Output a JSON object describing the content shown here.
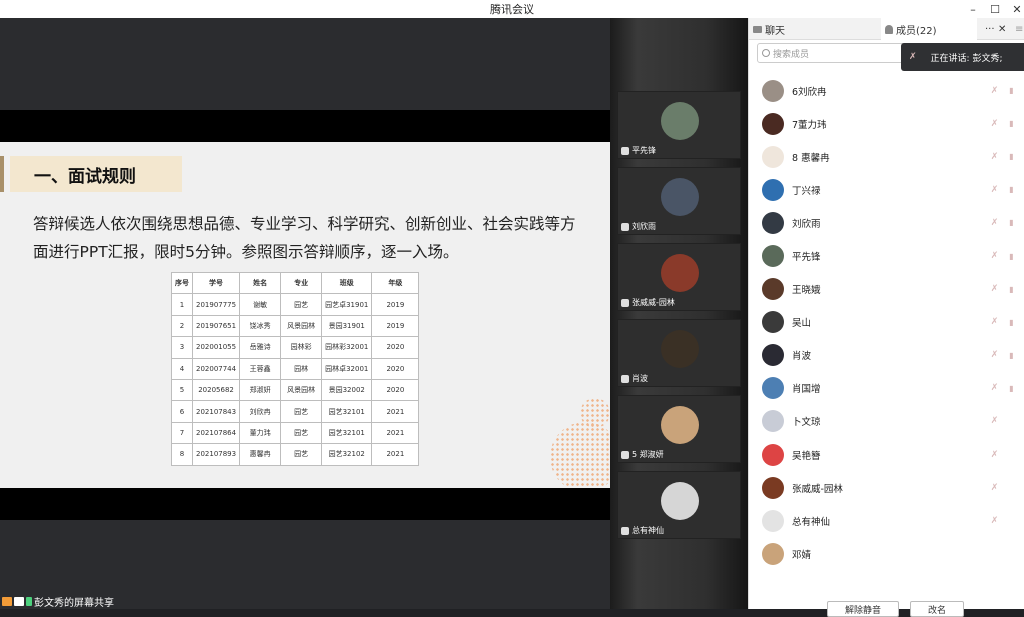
{
  "window": {
    "title": "腾讯会议",
    "minimize": "–",
    "maximize": "☐",
    "close": "✕"
  },
  "slide": {
    "heading": "一、面试规则",
    "body": "答辩候选人依次围绕思想品德、专业学习、科学研究、创新创业、社会实践等方面进行PPT汇报，限时5分钟。参照图示答辩顺序，逐一入场。",
    "table": {
      "headers": [
        "序号",
        "学号",
        "姓名",
        "专业",
        "班级",
        "年级"
      ],
      "rows": [
        [
          "1",
          "201907775",
          "谢敏",
          "园艺",
          "园艺卓31901",
          "2019"
        ],
        [
          "2",
          "201907651",
          "饶冰秀",
          "风景园林",
          "景园31901",
          "2019"
        ],
        [
          "3",
          "202001055",
          "岳雅诗",
          "园林彩",
          "园林彩32001",
          "2020"
        ],
        [
          "4",
          "202007744",
          "王蓉鑫",
          "园林",
          "园林卓32001",
          "2020"
        ],
        [
          "5",
          "20205682",
          "郑淑妍",
          "风景园林",
          "景园32002",
          "2020"
        ],
        [
          "6",
          "202107843",
          "刘欣冉",
          "园艺",
          "园艺32101",
          "2021"
        ],
        [
          "7",
          "202107864",
          "董力玮",
          "园艺",
          "园艺32101",
          "2021"
        ],
        [
          "8",
          "202107893",
          "惠馨冉",
          "园艺",
          "园艺32102",
          "2021"
        ]
      ]
    }
  },
  "sharer": "彭文秀的屏幕共享",
  "gallery": [
    "平先锋",
    "刘欣雨",
    "张威威-园林",
    "肖波",
    "5 郑淑妍",
    "总有神仙"
  ],
  "panel": {
    "tab_chat": "聊天",
    "tab_members": "成员(22)",
    "more": "···",
    "close": "✕",
    "menu": "≡",
    "search_placeholder": "搜索成员",
    "speaking": "正在讲话: 彭文秀;",
    "mute_all": "解除静音",
    "rename": "改名"
  },
  "members": [
    {
      "name": "6刘欣冉",
      "mic": "muted",
      "cam": "off"
    },
    {
      "name": "7董力玮",
      "mic": "muted",
      "cam": "off"
    },
    {
      "name": "8 惠馨冉",
      "mic": "muted",
      "cam": "off"
    },
    {
      "name": "丁兴禄",
      "mic": "muted",
      "cam": "off"
    },
    {
      "name": "刘欣雨",
      "mic": "muted",
      "cam": "off"
    },
    {
      "name": "平先锋",
      "mic": "muted",
      "cam": "off"
    },
    {
      "name": "王晓娥",
      "mic": "muted",
      "cam": "off"
    },
    {
      "name": "吴山",
      "mic": "muted",
      "cam": "off"
    },
    {
      "name": "肖波",
      "mic": "muted",
      "cam": "off"
    },
    {
      "name": "肖国增",
      "mic": "muted",
      "cam": "off"
    },
    {
      "name": "卜文琼",
      "mic": "muted",
      "cam": ""
    },
    {
      "name": "吴艳簪",
      "mic": "muted",
      "cam": ""
    },
    {
      "name": "张威威-园林",
      "mic": "muted",
      "cam": ""
    },
    {
      "name": "总有神仙",
      "mic": "muted",
      "cam": ""
    },
    {
      "name": "邓婧",
      "mic": "",
      "cam": ""
    }
  ],
  "colors": {
    "accent": "#a8906a",
    "slide_heading_bg": "#f3e7cf",
    "muted_icon": "#d9b9b9"
  }
}
